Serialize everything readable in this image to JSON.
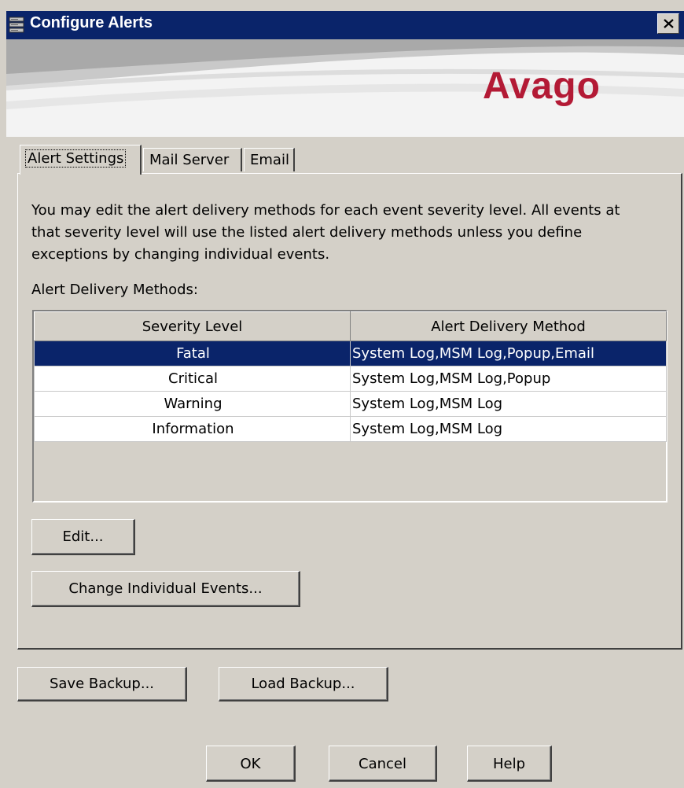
{
  "window": {
    "title": "Configure Alerts",
    "icon": "server-stack-icon",
    "close_icon": "close-icon"
  },
  "header": {
    "logo_text": "Avago",
    "logo_color": "#b31a35"
  },
  "tabs": [
    {
      "label": "Alert Settings",
      "active": true
    },
    {
      "label": "Mail Server",
      "active": false
    },
    {
      "label": "Email",
      "active": false
    }
  ],
  "alert_settings": {
    "description": "You may edit the alert delivery methods for each event severity level. All events at that severity level will use the listed alert delivery methods unless you define exceptions by changing individual events.",
    "methods_label": "Alert Delivery Methods:",
    "table": {
      "columns": [
        "Severity Level",
        "Alert Delivery Method"
      ],
      "rows": [
        {
          "severity": "Fatal",
          "method": "System Log,MSM Log,Popup,Email",
          "selected": true
        },
        {
          "severity": "Critical",
          "method": "System Log,MSM Log,Popup",
          "selected": false
        },
        {
          "severity": "Warning",
          "method": "System Log,MSM Log",
          "selected": false
        },
        {
          "severity": "Information",
          "method": "System Log,MSM Log",
          "selected": false
        }
      ]
    },
    "edit_label": "Edit...",
    "change_events_label": "Change Individual Events..."
  },
  "backup": {
    "save_label": "Save Backup...",
    "load_label": "Load Backup..."
  },
  "footer": {
    "ok_label": "OK",
    "cancel_label": "Cancel",
    "help_label": "Help"
  },
  "colors": {
    "titlebar": "#0a246a",
    "selection": "#0a246a",
    "dialog_bg": "#d4d0c8"
  }
}
